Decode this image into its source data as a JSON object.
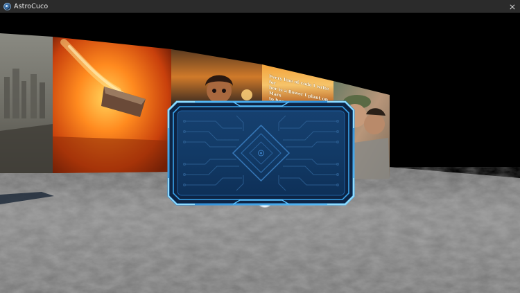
{
  "window": {
    "title": "AstroCuco"
  },
  "gallery": {
    "paintings": [
      {
        "subject": "ruined city skyline"
      },
      {
        "subject": "flaming meteor falling over lava plain"
      },
      {
        "subject": "cartoon girl at sunset"
      },
      {
        "subject": "poem card",
        "text_line1": "Every line of code I write for",
        "text_line2": "her is a flower I plant on Mars",
        "text_line3": "to her name"
      },
      {
        "subject": "two people embracing"
      }
    ]
  },
  "colors": {
    "panel_border": "#2e8ed8",
    "panel_fill": "#123a6b",
    "titlebar": "#2b2b2b",
    "moon_ground": "#8a8a8a"
  },
  "icons": {
    "app": "astrocuco-app-icon",
    "close": "close-icon"
  }
}
